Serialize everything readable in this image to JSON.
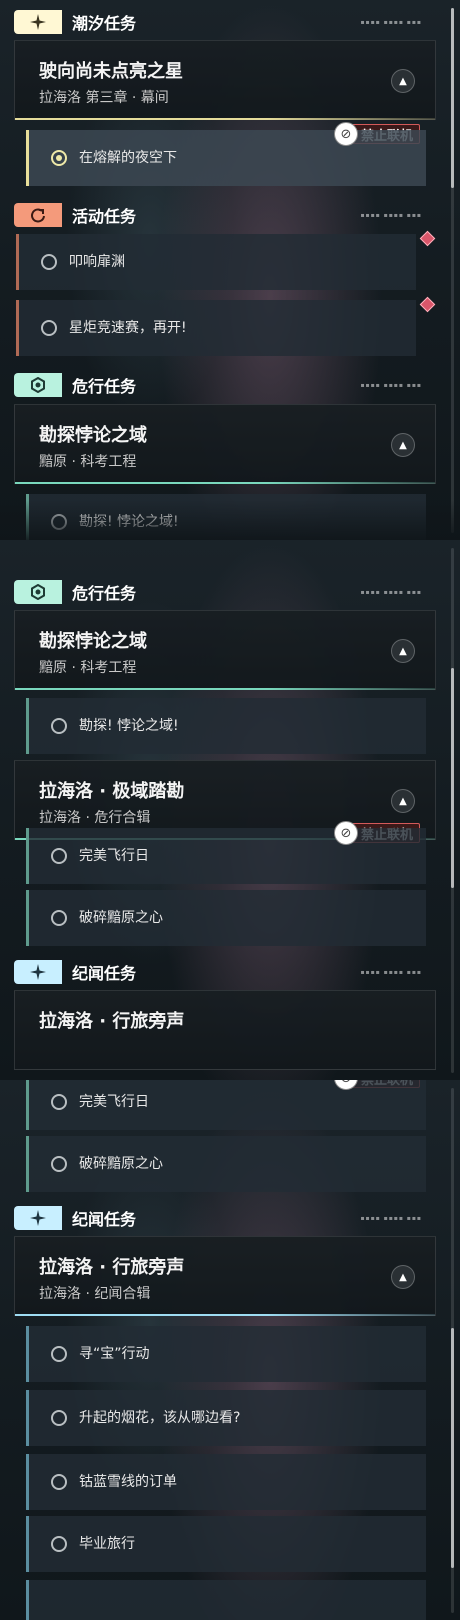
{
  "categories": {
    "tide": {
      "label": "潮汐任务",
      "icon": "sparkle-icon",
      "color": "#c9bf7a"
    },
    "event": {
      "label": "活动任务",
      "icon": "cycle-icon",
      "color": "#e0735b"
    },
    "peril": {
      "label": "危行任务",
      "icon": "gear-hex-icon",
      "color": "#6fcdb0"
    },
    "record": {
      "label": "纪闻任务",
      "icon": "sparkle-icon",
      "color": "#8cd6f0"
    }
  },
  "quests": {
    "star": {
      "title": "驶向尚未点亮之星",
      "subtitle": "拉海洛 第三章 · 幕间"
    },
    "paradox": {
      "title": "勘探悖论之域",
      "subtitle": "黯原 · 科考工程"
    },
    "polar": {
      "title": "拉海洛 · 极域踏勘",
      "subtitle": "拉海洛 · 危行合辑"
    },
    "travel": {
      "title": "拉海洛 · 行旅旁声",
      "subtitle": "拉海洛 · 纪闻合辑"
    }
  },
  "tasks": {
    "night_sky": "在熔解的夜空下",
    "abyss": "叩响扉渊",
    "torch": "星炬竞速赛，再开!",
    "explore": "勘探! 悖论之域!",
    "perfect_flight": "完美飞行日",
    "shatter": "破碎黯原之心",
    "treasure": "寻“宝”行动",
    "fireworks": "升起的烟花，该从哪边看?",
    "cobalt": "钴蓝雪线的订单",
    "graduation": "毕业旅行"
  },
  "coop_badge": "禁止联机"
}
